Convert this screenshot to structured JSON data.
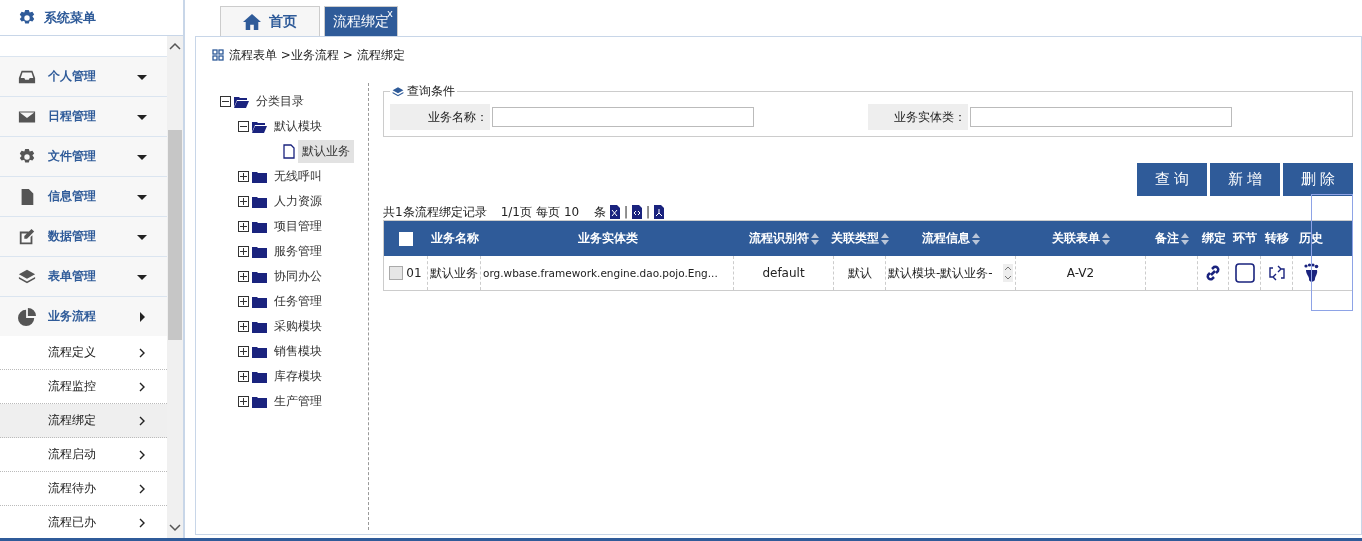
{
  "sidebar": {
    "title": "系统菜单",
    "items": [
      {
        "kind": "group",
        "label": "个人管理",
        "expanded": false,
        "selected": false
      },
      {
        "kind": "group",
        "label": "日程管理",
        "expanded": false,
        "selected": false
      },
      {
        "kind": "group",
        "label": "文件管理",
        "expanded": false,
        "selected": false
      },
      {
        "kind": "group",
        "label": "信息管理",
        "expanded": false,
        "selected": false
      },
      {
        "kind": "group",
        "label": "数据管理",
        "expanded": false,
        "selected": false
      },
      {
        "kind": "group",
        "label": "表单管理",
        "expanded": false,
        "selected": false
      },
      {
        "kind": "group",
        "label": "业务流程",
        "expanded": true,
        "selected": false
      },
      {
        "kind": "sub",
        "label": "流程定义",
        "selected": false
      },
      {
        "kind": "sub",
        "label": "流程监控",
        "selected": false
      },
      {
        "kind": "sub",
        "label": "流程绑定",
        "selected": true
      },
      {
        "kind": "sub",
        "label": "流程启动",
        "selected": false
      },
      {
        "kind": "sub",
        "label": "流程待办",
        "selected": false
      },
      {
        "kind": "sub",
        "label": "流程已办",
        "selected": false
      }
    ]
  },
  "tabs": [
    {
      "label": "首页",
      "selected": false
    },
    {
      "label": "流程绑定",
      "selected": true,
      "close": "x"
    }
  ],
  "breadcrumb": "流程表单 >业务流程 > 流程绑定",
  "tree": [
    {
      "label": "分类目录",
      "kind": "folder",
      "expanded": true,
      "selected": false,
      "children": [
        {
          "label": "默认模块",
          "kind": "folder",
          "expanded": true,
          "selected": false,
          "children": [
            {
              "label": "默认业务",
              "kind": "file",
              "selected": true
            }
          ]
        },
        {
          "label": "无线呼叫",
          "kind": "folder",
          "expanded": false,
          "selected": false
        },
        {
          "label": "人力资源",
          "kind": "folder",
          "expanded": false,
          "selected": false
        },
        {
          "label": "项目管理",
          "kind": "folder",
          "expanded": false,
          "selected": false
        },
        {
          "label": "服务管理",
          "kind": "folder",
          "expanded": false,
          "selected": false
        },
        {
          "label": "协同办公",
          "kind": "folder",
          "expanded": false,
          "selected": false
        },
        {
          "label": "任务管理",
          "kind": "folder",
          "expanded": false,
          "selected": false
        },
        {
          "label": "采购模块",
          "kind": "folder",
          "expanded": false,
          "selected": false
        },
        {
          "label": "销售模块",
          "kind": "folder",
          "expanded": false,
          "selected": false
        },
        {
          "label": "库存模块",
          "kind": "folder",
          "expanded": false,
          "selected": false
        },
        {
          "label": "生产管理",
          "kind": "folder",
          "expanded": false,
          "selected": false
        }
      ]
    }
  ],
  "query": {
    "legend": "查询条件",
    "fields": [
      {
        "label": "业务名称："
      },
      {
        "label": "业务实体类："
      }
    ]
  },
  "buttons": [
    "查 询",
    "新 增",
    "删 除"
  ],
  "summary": {
    "total": "共1条流程绑定记录",
    "page": "1/1页",
    "per_page": "每页",
    "page_size": "10",
    "unit": "条",
    "separators": [
      "|",
      "|"
    ]
  },
  "table": {
    "header_checked": false,
    "columns": [
      {
        "label": "业务名称",
        "sortable": false
      },
      {
        "label": "业务实体类",
        "sortable": false
      },
      {
        "label": "流程识别符",
        "sortable": true
      },
      {
        "label": "关联类型",
        "sortable": true
      },
      {
        "label": "流程信息",
        "sortable": true
      },
      {
        "label": "关联表单",
        "sortable": true
      },
      {
        "label": "备注",
        "sortable": true
      },
      {
        "label": "绑定",
        "sortable": false
      },
      {
        "label": "环节",
        "sortable": false
      },
      {
        "label": "转移",
        "sortable": false
      },
      {
        "label": "历史",
        "sortable": false,
        "focused": true
      }
    ],
    "rows": [
      {
        "checked": false,
        "index": "01",
        "name": "默认业务",
        "entity": "org.wbase.framework.engine.dao.pojo.Eng...",
        "identifier": "default",
        "type": "默认",
        "info": "默认模块-默认业务-",
        "form": "A-V2"
      }
    ]
  }
}
